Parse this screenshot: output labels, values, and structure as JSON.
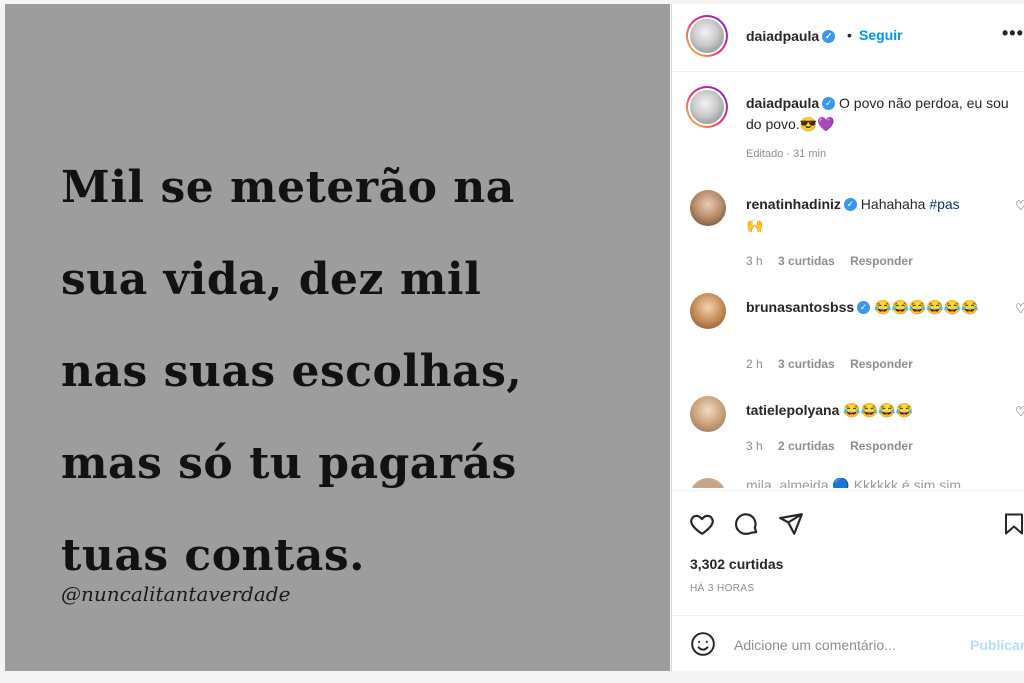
{
  "post": {
    "quote_lines": [
      "Mil se meterão na",
      "sua vida, dez mil",
      "nas suas escolhas,",
      "mas só tu pagarás",
      "tuas contas."
    ],
    "quote_credit": "@nuncalitantaverdade"
  },
  "header": {
    "username": "daiadpaula",
    "dot": "•",
    "follow_label": "Seguir",
    "more_icon": "more-horizontal-icon"
  },
  "caption": {
    "username": "daiadpaula",
    "text": "O povo não perdoa, eu sou do povo.😎💜",
    "meta": "Editado · 31 min"
  },
  "comments": [
    {
      "username": "renatinhadiniz",
      "verified": true,
      "text": "Hahahaha ",
      "hashtag": "#pas",
      "text2": "🙌",
      "time": "3 h",
      "likes": "3 curtidas",
      "reply": "Responder"
    },
    {
      "username": "brunasantosbss",
      "verified": true,
      "text": "😂😂😂😂😂😂",
      "time": "2 h",
      "likes": "3 curtidas",
      "reply": "Responder"
    },
    {
      "username": "tatielepolyana",
      "verified": false,
      "text": "😂😂😂😂",
      "time": "3 h",
      "likes": "2 curtidas",
      "reply": "Responder"
    }
  ],
  "partial_comment": "mila_almeida 🔵 Kkkkkk é sim sim",
  "actions": {
    "like_icon": "heart-icon",
    "comment_icon": "comment-icon",
    "share_icon": "send-icon",
    "save_icon": "bookmark-icon"
  },
  "likes_count": "3,302 curtidas",
  "time_ago": "HÁ 3 HORAS",
  "add_comment": {
    "emoji_icon": "smiley-icon",
    "placeholder": "Adicione um comentário...",
    "post_label": "Publicar"
  },
  "colors": {
    "accent": "#0095f6",
    "post_disabled": "#b2dffc",
    "image_bg": "#9d9d9d",
    "verified": "#3897f0"
  }
}
